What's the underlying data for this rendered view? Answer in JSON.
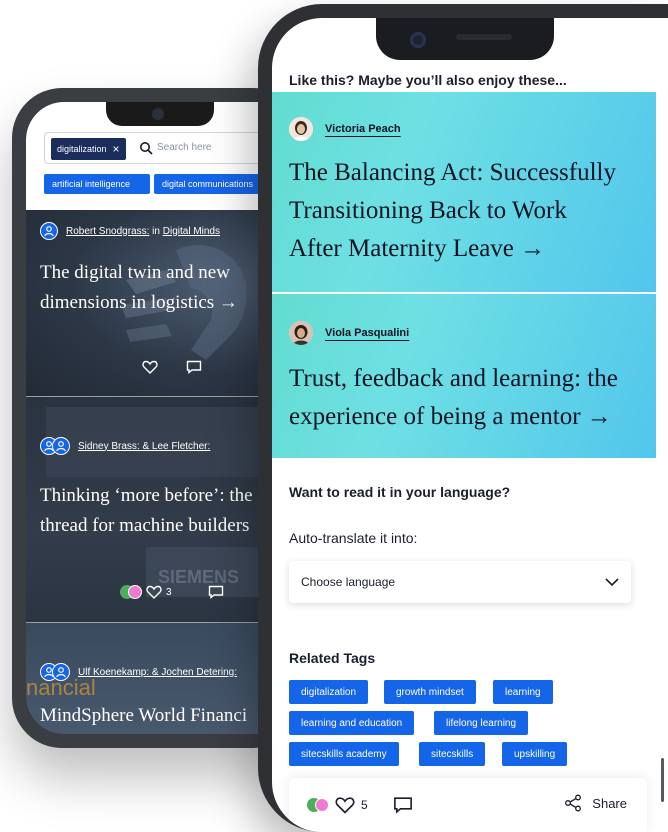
{
  "back_phone": {
    "search": {
      "chip": "digitalization",
      "placeholder": "Search here"
    },
    "tags": [
      "artificial intelligence",
      "digital communications"
    ],
    "cards": [
      {
        "author": "Robert Snodgrass:",
        "in_label": "in",
        "channel": "Digital Minds",
        "title_lines": [
          "The digital twin and new",
          "dimensions in logistics →"
        ],
        "reaction_count": ""
      },
      {
        "author": "Sidney Brass: & Lee Fletcher:",
        "title_lines": [
          "Thinking ‘more before’: the",
          "thread for machine builders"
        ],
        "reaction_count": "3",
        "bg_text": "SIEMENS"
      },
      {
        "author": "Ulf Koenekamp: & Jochen Detering:",
        "title_lines": [
          "MindSphere World Financi"
        ],
        "bg_text": "nancial"
      }
    ]
  },
  "front_phone": {
    "enjoy_heading": "Like this? Maybe you’ll also enjoy these...",
    "recommendations": [
      {
        "author": "Victoria Peach",
        "title_lines": [
          "The Balancing Act: Successfully",
          "Transitioning Back to Work",
          "After Maternity Leave →"
        ]
      },
      {
        "author": "Viola Pasqualini",
        "title_lines": [
          "Trust, feedback and learning: the",
          "experience of being a mentor →"
        ]
      }
    ],
    "language": {
      "heading": "Want to read it in your language?",
      "sub": "Auto-translate it into:",
      "select_value": "Choose language"
    },
    "related": {
      "heading": "Related Tags",
      "tags": [
        "digitalization",
        "growth mindset",
        "learning",
        "learning and education",
        "lifelong learning",
        "sitecskills academy",
        "sitecskills",
        "upskilling"
      ]
    },
    "bottom_bar": {
      "reaction_count": "5",
      "share_label": "Share"
    }
  },
  "colors": {
    "accent_blue": "#1565e8",
    "dark_chip": "#1b2d5c",
    "gradient_teal": "#62dcd0",
    "gradient_blue": "#52c6ec"
  }
}
